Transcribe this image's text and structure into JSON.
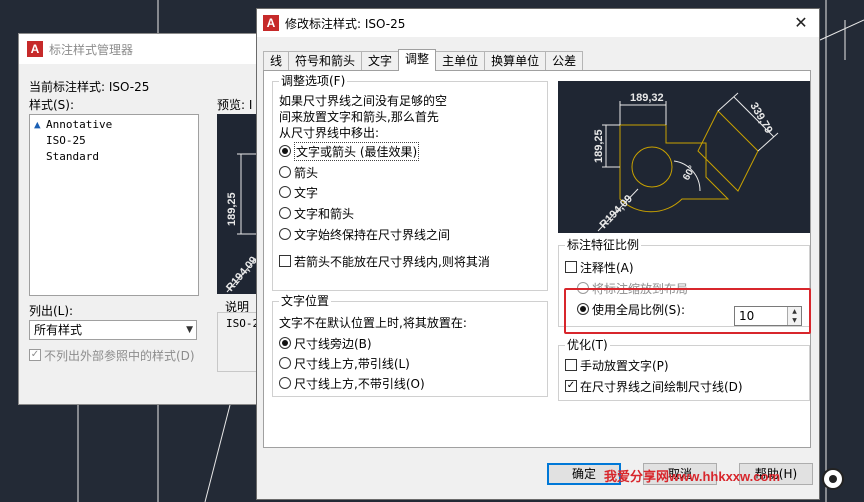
{
  "manager": {
    "title": "标注样式管理器",
    "current_style_label": "当前标注样式: ISO-25",
    "styles_label": "样式(S):",
    "styles": [
      "Annotative",
      "ISO-25",
      "Standard"
    ],
    "preview_label": "预览: I",
    "preview_dim": "189,25",
    "preview_radius": "R194,09",
    "list_label": "列出(L):",
    "list_value": "所有样式",
    "exclude_xref_label": "不列出外部参照中的样式(D)",
    "description_label": "说明",
    "description_value": "ISO-2"
  },
  "dialog": {
    "title": "修改标注样式: ISO-25",
    "tabs": [
      "线",
      "符号和箭头",
      "文字",
      "调整",
      "主单位",
      "换算单位",
      "公差"
    ],
    "active_tab": "调整",
    "fit_options": {
      "title": "调整选项(F)",
      "line1": "如果尺寸界线之间没有足够的空",
      "line2": "间来放置文字和箭头,那么首先",
      "line3": "从尺寸界线中移出:",
      "radios": [
        "文字或箭头 (最佳效果)",
        "箭头",
        "文字",
        "文字和箭头",
        "文字始终保持在尺寸界线之间"
      ],
      "suppress_arrows": "若箭头不能放在尺寸界线内,则将其消"
    },
    "text_placement": {
      "title": "文字位置",
      "desc": "文字不在默认位置上时,将其放置在:",
      "radios": [
        "尺寸线旁边(B)",
        "尺寸线上方,带引线(L)",
        "尺寸线上方,不带引线(O)"
      ]
    },
    "preview": {
      "dim_top": "189,32",
      "dim_left": "189,25",
      "dim_right": "339,79",
      "angle": "60°",
      "radius": "R194,09"
    },
    "scale": {
      "title": "标注特征比例",
      "annotative": "注释性(A)",
      "scale_to_layout": "将标注缩放到布局",
      "use_overall": "使用全局比例(S):",
      "overall_value": "10"
    },
    "fine_tuning": {
      "title": "优化(T)",
      "manual_place": "手动放置文字(P)",
      "draw_dim_line": "在尺寸界线之间绘制尺寸线(D)"
    },
    "buttons": {
      "ok": "确定",
      "cancel": "取消",
      "help": "帮助(H)"
    }
  },
  "watermark": "我爱分享网www.hhkxxw.com"
}
